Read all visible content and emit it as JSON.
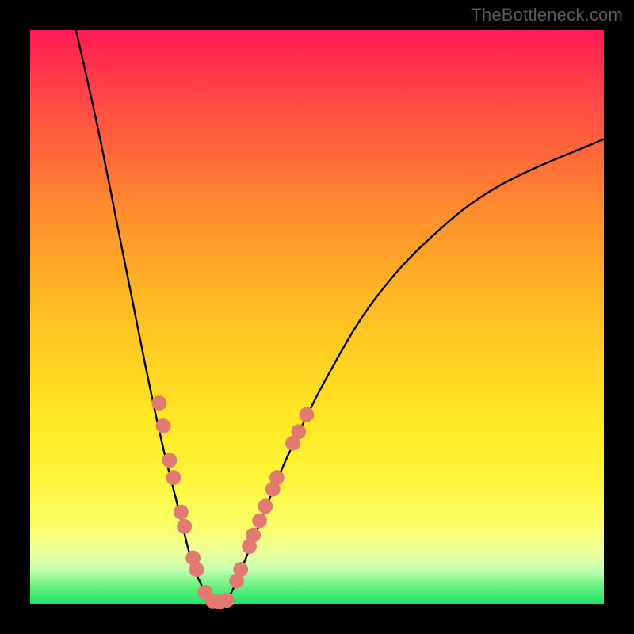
{
  "watermark": "TheBottleneck.com",
  "colors": {
    "dot": "#e17b72",
    "curve": "#000000",
    "stage_bg": "#000000"
  },
  "chart_data": {
    "type": "line",
    "title": "",
    "xlabel": "",
    "ylabel": "",
    "xlim": [
      0,
      100
    ],
    "ylim": [
      0,
      100
    ],
    "grid": false,
    "legend": false,
    "curve": {
      "left_leg": [
        {
          "x": 8,
          "y": 100
        },
        {
          "x": 12,
          "y": 82
        },
        {
          "x": 16,
          "y": 62
        },
        {
          "x": 20,
          "y": 42
        },
        {
          "x": 23,
          "y": 28
        },
        {
          "x": 26,
          "y": 16
        },
        {
          "x": 28,
          "y": 8
        },
        {
          "x": 30,
          "y": 3
        },
        {
          "x": 32,
          "y": 0
        }
      ],
      "right_leg": [
        {
          "x": 34,
          "y": 0
        },
        {
          "x": 36,
          "y": 4
        },
        {
          "x": 40,
          "y": 14
        },
        {
          "x": 45,
          "y": 26
        },
        {
          "x": 52,
          "y": 40
        },
        {
          "x": 60,
          "y": 53
        },
        {
          "x": 70,
          "y": 64
        },
        {
          "x": 82,
          "y": 73
        },
        {
          "x": 100,
          "y": 81
        }
      ]
    },
    "markers": [
      {
        "x": 22.5,
        "y": 35,
        "r": 1.3
      },
      {
        "x": 23.2,
        "y": 31,
        "r": 1.3
      },
      {
        "x": 24.3,
        "y": 25,
        "r": 1.3
      },
      {
        "x": 25.0,
        "y": 22,
        "r": 1.3
      },
      {
        "x": 26.3,
        "y": 16,
        "r": 1.3
      },
      {
        "x": 26.9,
        "y": 13.5,
        "r": 1.3
      },
      {
        "x": 28.4,
        "y": 8,
        "r": 1.3
      },
      {
        "x": 29.0,
        "y": 6,
        "r": 1.3
      },
      {
        "x": 30.5,
        "y": 2,
        "r": 1.3
      },
      {
        "x": 31.8,
        "y": 0.5,
        "r": 1.3
      },
      {
        "x": 33.0,
        "y": 0.3,
        "r": 1.3
      },
      {
        "x": 34.3,
        "y": 0.6,
        "r": 1.3
      },
      {
        "x": 36.0,
        "y": 4,
        "r": 1.3
      },
      {
        "x": 36.7,
        "y": 6,
        "r": 1.3
      },
      {
        "x": 38.2,
        "y": 10,
        "r": 1.3
      },
      {
        "x": 38.9,
        "y": 12,
        "r": 1.3
      },
      {
        "x": 40.0,
        "y": 14.5,
        "r": 1.3
      },
      {
        "x": 41.0,
        "y": 17,
        "r": 1.3
      },
      {
        "x": 42.3,
        "y": 20,
        "r": 1.3
      },
      {
        "x": 43.0,
        "y": 22,
        "r": 1.3
      },
      {
        "x": 45.8,
        "y": 28,
        "r": 1.3
      },
      {
        "x": 46.8,
        "y": 30,
        "r": 1.3
      },
      {
        "x": 48.2,
        "y": 33,
        "r": 1.3
      }
    ]
  }
}
